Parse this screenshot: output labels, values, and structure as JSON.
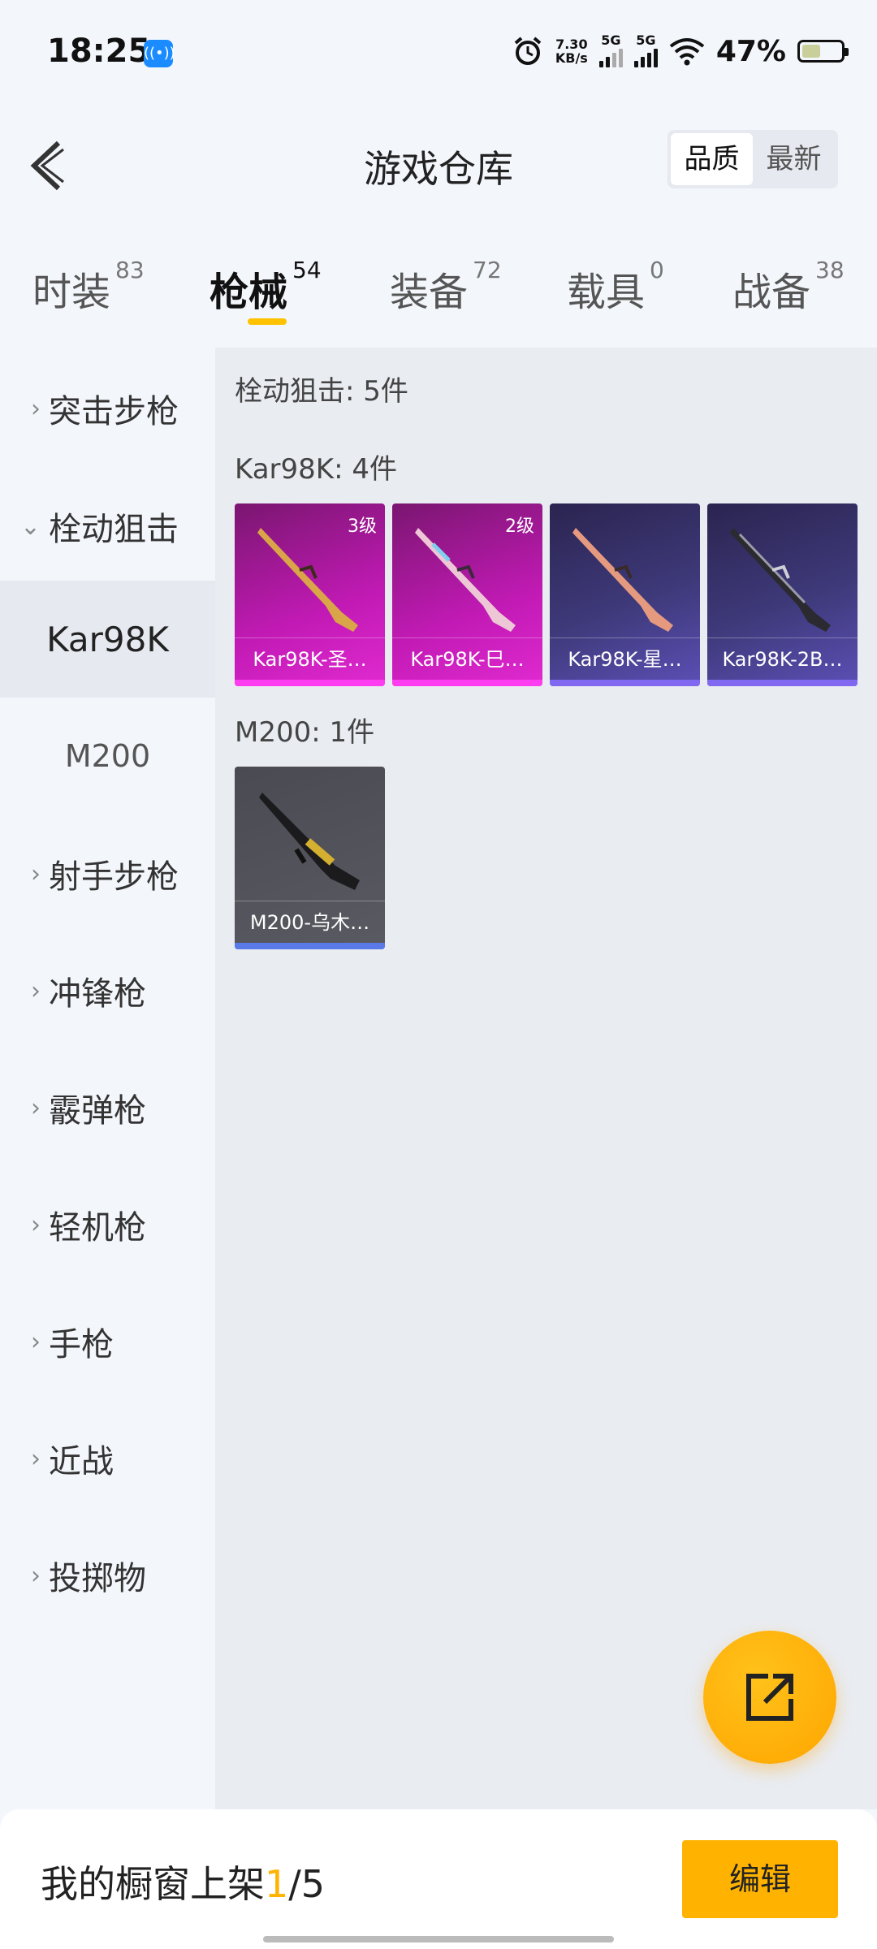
{
  "status_bar": {
    "time": "18:25",
    "net_speed_value": "7.30",
    "net_speed_unit": "KB/s",
    "sim1": "5G",
    "sim2": "5G",
    "battery": "47%",
    "battery_level": 0.47
  },
  "header": {
    "title": "游戏仓库",
    "sort_quality": "品质",
    "sort_latest": "最新"
  },
  "tabs": [
    {
      "label": "时装",
      "count": "83"
    },
    {
      "label": "枪械",
      "count": "54"
    },
    {
      "label": "装备",
      "count": "72"
    },
    {
      "label": "载具",
      "count": "0"
    },
    {
      "label": "战备",
      "count": "38"
    }
  ],
  "sidebar": {
    "items": [
      {
        "label": "突击步枪"
      },
      {
        "label": "栓动狙击"
      },
      {
        "label": "Kar98K"
      },
      {
        "label": "M200"
      },
      {
        "label": "射手步枪"
      },
      {
        "label": "冲锋枪"
      },
      {
        "label": "霰弹枪"
      },
      {
        "label": "轻机枪"
      },
      {
        "label": "手枪"
      },
      {
        "label": "近战"
      },
      {
        "label": "投掷物"
      }
    ]
  },
  "content": {
    "category_title": "栓动狙击: 5件",
    "groups": [
      {
        "title": "Kar98K: 4件",
        "items": [
          {
            "name": "Kar98K-圣…",
            "level": "3级",
            "quality": "pink"
          },
          {
            "name": "Kar98K-巳…",
            "level": "2级",
            "quality": "pink"
          },
          {
            "name": "Kar98K-星…",
            "level": "",
            "quality": "purple"
          },
          {
            "name": "Kar98K-2B…",
            "level": "",
            "quality": "purple"
          }
        ]
      },
      {
        "title": "M200: 1件",
        "items": [
          {
            "name": "M200-乌木…",
            "level": "",
            "quality": "gray"
          }
        ]
      }
    ]
  },
  "bottom_bar": {
    "shelf_prefix": "我的橱窗上架",
    "shelf_current": "1",
    "shelf_total": "/5",
    "edit_label": "编辑"
  },
  "icons": {
    "back": "chevron-left-icon",
    "fab": "share-external-icon",
    "cast": "broadcast-icon",
    "alarm": "alarm-icon",
    "wifi": "wifi-icon"
  },
  "colors": {
    "accent": "#ffb300",
    "pink_quality": "#d21ec4",
    "purple_quality": "#4b3f8f",
    "gray_quality": "#55555c"
  }
}
